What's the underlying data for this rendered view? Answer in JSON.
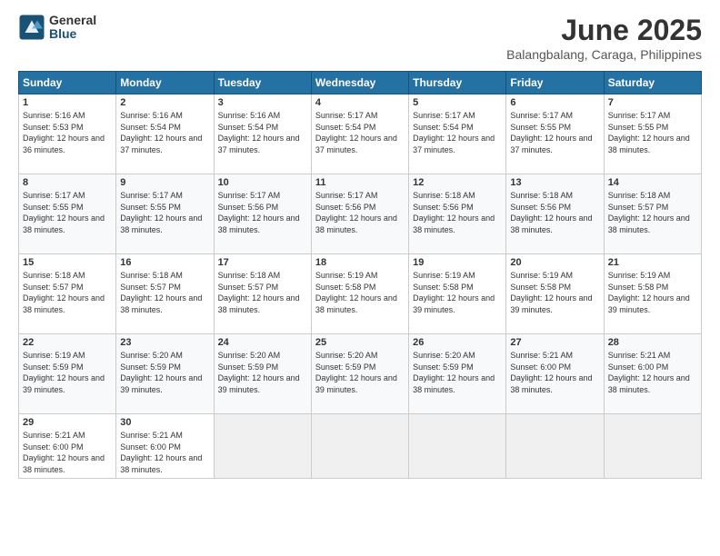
{
  "logo": {
    "general": "General",
    "blue": "Blue"
  },
  "title": "June 2025",
  "location": "Balangbalang, Caraga, Philippines",
  "headers": [
    "Sunday",
    "Monday",
    "Tuesday",
    "Wednesday",
    "Thursday",
    "Friday",
    "Saturday"
  ],
  "weeks": [
    [
      {
        "day": "1",
        "sunrise": "5:16 AM",
        "sunset": "5:53 PM",
        "daylight": "12 hours and 36 minutes."
      },
      {
        "day": "2",
        "sunrise": "5:16 AM",
        "sunset": "5:54 PM",
        "daylight": "12 hours and 37 minutes."
      },
      {
        "day": "3",
        "sunrise": "5:16 AM",
        "sunset": "5:54 PM",
        "daylight": "12 hours and 37 minutes."
      },
      {
        "day": "4",
        "sunrise": "5:17 AM",
        "sunset": "5:54 PM",
        "daylight": "12 hours and 37 minutes."
      },
      {
        "day": "5",
        "sunrise": "5:17 AM",
        "sunset": "5:54 PM",
        "daylight": "12 hours and 37 minutes."
      },
      {
        "day": "6",
        "sunrise": "5:17 AM",
        "sunset": "5:55 PM",
        "daylight": "12 hours and 37 minutes."
      },
      {
        "day": "7",
        "sunrise": "5:17 AM",
        "sunset": "5:55 PM",
        "daylight": "12 hours and 38 minutes."
      }
    ],
    [
      {
        "day": "8",
        "sunrise": "5:17 AM",
        "sunset": "5:55 PM",
        "daylight": "12 hours and 38 minutes."
      },
      {
        "day": "9",
        "sunrise": "5:17 AM",
        "sunset": "5:55 PM",
        "daylight": "12 hours and 38 minutes."
      },
      {
        "day": "10",
        "sunrise": "5:17 AM",
        "sunset": "5:56 PM",
        "daylight": "12 hours and 38 minutes."
      },
      {
        "day": "11",
        "sunrise": "5:17 AM",
        "sunset": "5:56 PM",
        "daylight": "12 hours and 38 minutes."
      },
      {
        "day": "12",
        "sunrise": "5:18 AM",
        "sunset": "5:56 PM",
        "daylight": "12 hours and 38 minutes."
      },
      {
        "day": "13",
        "sunrise": "5:18 AM",
        "sunset": "5:56 PM",
        "daylight": "12 hours and 38 minutes."
      },
      {
        "day": "14",
        "sunrise": "5:18 AM",
        "sunset": "5:57 PM",
        "daylight": "12 hours and 38 minutes."
      }
    ],
    [
      {
        "day": "15",
        "sunrise": "5:18 AM",
        "sunset": "5:57 PM",
        "daylight": "12 hours and 38 minutes."
      },
      {
        "day": "16",
        "sunrise": "5:18 AM",
        "sunset": "5:57 PM",
        "daylight": "12 hours and 38 minutes."
      },
      {
        "day": "17",
        "sunrise": "5:18 AM",
        "sunset": "5:57 PM",
        "daylight": "12 hours and 38 minutes."
      },
      {
        "day": "18",
        "sunrise": "5:19 AM",
        "sunset": "5:58 PM",
        "daylight": "12 hours and 38 minutes."
      },
      {
        "day": "19",
        "sunrise": "5:19 AM",
        "sunset": "5:58 PM",
        "daylight": "12 hours and 39 minutes."
      },
      {
        "day": "20",
        "sunrise": "5:19 AM",
        "sunset": "5:58 PM",
        "daylight": "12 hours and 39 minutes."
      },
      {
        "day": "21",
        "sunrise": "5:19 AM",
        "sunset": "5:58 PM",
        "daylight": "12 hours and 39 minutes."
      }
    ],
    [
      {
        "day": "22",
        "sunrise": "5:19 AM",
        "sunset": "5:59 PM",
        "daylight": "12 hours and 39 minutes."
      },
      {
        "day": "23",
        "sunrise": "5:20 AM",
        "sunset": "5:59 PM",
        "daylight": "12 hours and 39 minutes."
      },
      {
        "day": "24",
        "sunrise": "5:20 AM",
        "sunset": "5:59 PM",
        "daylight": "12 hours and 39 minutes."
      },
      {
        "day": "25",
        "sunrise": "5:20 AM",
        "sunset": "5:59 PM",
        "daylight": "12 hours and 39 minutes."
      },
      {
        "day": "26",
        "sunrise": "5:20 AM",
        "sunset": "5:59 PM",
        "daylight": "12 hours and 38 minutes."
      },
      {
        "day": "27",
        "sunrise": "5:21 AM",
        "sunset": "6:00 PM",
        "daylight": "12 hours and 38 minutes."
      },
      {
        "day": "28",
        "sunrise": "5:21 AM",
        "sunset": "6:00 PM",
        "daylight": "12 hours and 38 minutes."
      }
    ],
    [
      {
        "day": "29",
        "sunrise": "5:21 AM",
        "sunset": "6:00 PM",
        "daylight": "12 hours and 38 minutes."
      },
      {
        "day": "30",
        "sunrise": "5:21 AM",
        "sunset": "6:00 PM",
        "daylight": "12 hours and 38 minutes."
      },
      null,
      null,
      null,
      null,
      null
    ]
  ]
}
